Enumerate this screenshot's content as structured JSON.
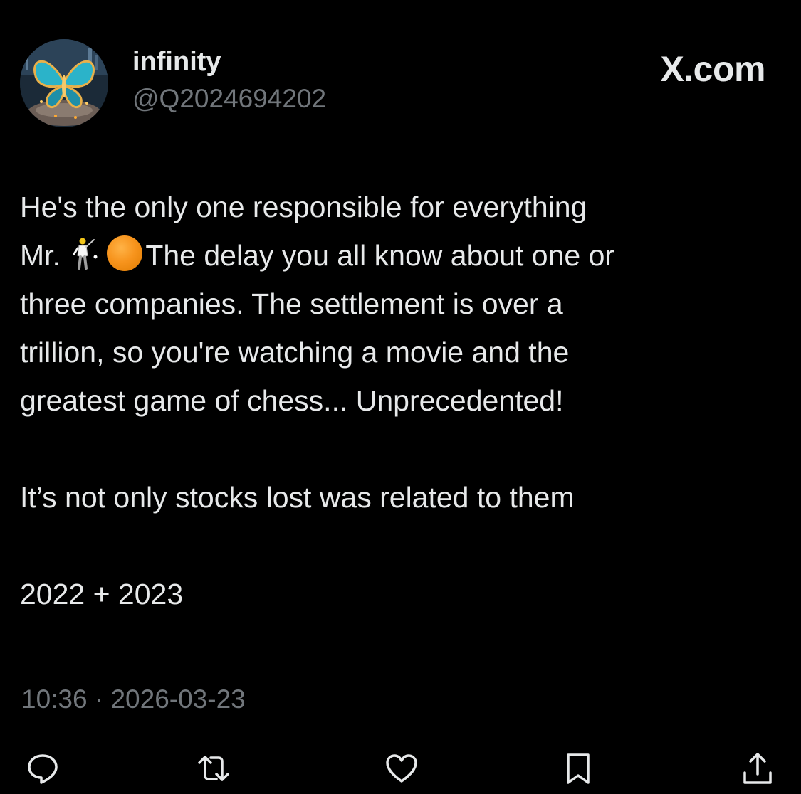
{
  "user": {
    "display_name": "infinity",
    "handle": "@Q2024694202"
  },
  "brand": "X.com",
  "tweet": {
    "line1": "He's the only one responsible for everything",
    "mr_prefix": "Mr. ",
    "line2_rest": "The delay you all know about one or",
    "line3": "three companies. The settlement is over a",
    "line4": "trillion, so you're watching a movie and the",
    "line5": "greatest game of chess... Unprecedented!",
    "para2": "It’s not only stocks lost was related to them",
    "para3": "2022 + 2023",
    "emoji_1": "golfer-icon",
    "emoji_2": "orange-circle-icon"
  },
  "timestamp": "10:36 · 2026-03-23",
  "actions": [
    "reply-icon",
    "retweet-icon",
    "like-icon",
    "bookmark-icon",
    "share-icon"
  ],
  "colors": {
    "background": "#000000",
    "text_primary": "#e7e9ea",
    "text_secondary": "#71767b",
    "orange_circle": "#f7941d"
  }
}
